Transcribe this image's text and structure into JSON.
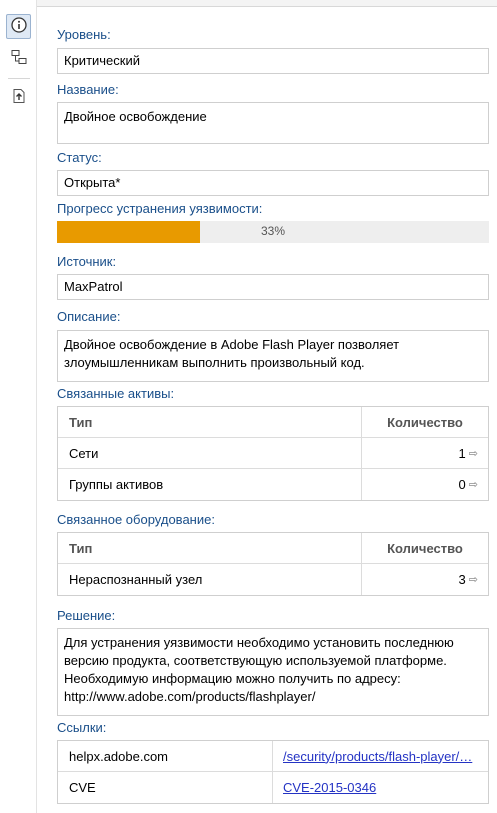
{
  "toolbar": {
    "items": [
      {
        "icon": "info-icon",
        "active": true
      },
      {
        "icon": "network-tree-icon",
        "active": false
      },
      {
        "icon": "export-icon",
        "active": false
      }
    ]
  },
  "fields": {
    "level_label": "Уровень:",
    "level_value": "Критический",
    "name_label": "Название:",
    "name_value": "Двойное освобождение",
    "status_label": "Статус:",
    "status_value": "Открыта*",
    "progress_label": "Прогресс устранения уязвимости:",
    "progress_percent": 33,
    "progress_text": "33%",
    "source_label": "Источник:",
    "source_value": "MaxPatrol",
    "description_label": "Описание:",
    "description_value": "Двойное освобождение в Adobe Flash Player позволяет злоумышленникам выполнить произвольный код.",
    "solution_label": "Решение:",
    "solution_value": "Для устранения уязвимости необходимо установить последнюю версию продукта, соответствующую используемой платформе. Необходимую информацию можно получить по адресу: http://www.adobe.com/products/flashplayer/"
  },
  "assets": {
    "label": "Связанные активы:",
    "col_type": "Тип",
    "col_count": "Количество",
    "rows": [
      {
        "type": "Сети",
        "count": "1"
      },
      {
        "type": "Группы активов",
        "count": "0"
      }
    ]
  },
  "hardware": {
    "label": "Связанное оборудование:",
    "col_type": "Тип",
    "col_count": "Количество",
    "rows": [
      {
        "type": "Нераспознанный узел",
        "count": "3"
      }
    ]
  },
  "links": {
    "label": "Ссылки:",
    "rows": [
      {
        "key": "helpx.adobe.com",
        "value": "/security/products/flash-player/…"
      },
      {
        "key": "CVE",
        "value": "CVE-2015-0346"
      }
    ]
  },
  "colors": {
    "label": "#1a4f8a",
    "progress": "#e89a00",
    "link": "#2433c4"
  }
}
